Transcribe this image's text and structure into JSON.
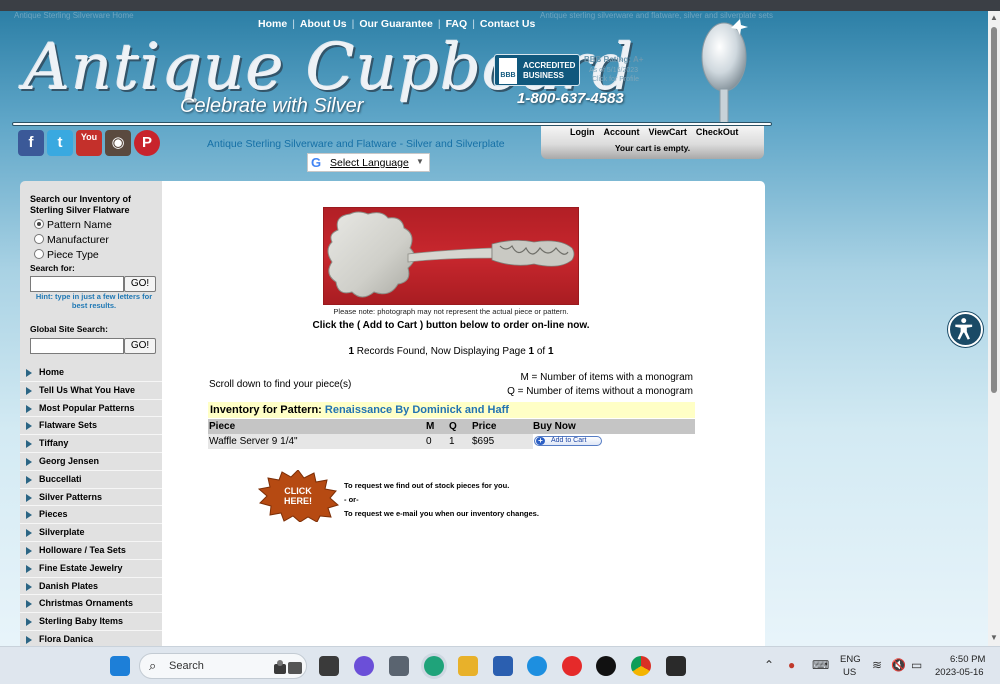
{
  "top_link": "Antique Sterling Silverware Home",
  "top_right_text": "Antique sterling silverware and flatware, silver and silverplate sets",
  "nav": [
    "Home",
    "About Us",
    "Our Guarantee",
    "FAQ",
    "Contact Us"
  ],
  "logo": {
    "title": "Antique Cupboard",
    "subtitle": "Celebrate with Silver"
  },
  "bbb": {
    "badge": "ACCREDITED BUSINESS",
    "icon": "BBB",
    "rating": "BBB Rating: A+",
    "as_of": "As of 5/16/2023",
    "click": "Click for Profile"
  },
  "phone": "1-800-637-4583",
  "tagline": "Antique Sterling Silverware and Flatware - Silver and Silverplate",
  "translate": {
    "label": "Select Language",
    "g": "G"
  },
  "account": {
    "links": [
      "Login",
      "Account",
      "ViewCart",
      "CheckOut"
    ],
    "cart_status": "Your cart is empty."
  },
  "social": [
    {
      "icon": "facebook-icon",
      "glyph": "f",
      "color": "#3b5998"
    },
    {
      "icon": "twitter-icon",
      "glyph": "t",
      "color": "#39a9e0"
    },
    {
      "icon": "youtube-icon",
      "glyph": "You",
      "color": "#c4302b"
    },
    {
      "icon": "instagram-icon",
      "glyph": "◉",
      "color": "#5a4a3f"
    },
    {
      "icon": "pinterest-icon",
      "glyph": "P",
      "color": "#c8232c"
    }
  ],
  "sidebar": {
    "search_title_1": "Search our Inventory of",
    "search_title_2": "Sterling Silver Flatware",
    "radios": [
      "Pattern Name",
      "Manufacturer",
      "Piece Type"
    ],
    "search_for": "Search for:",
    "go": "GO!",
    "hint_1": "Hint: type in just a few letters for",
    "hint_2": "best results.",
    "global_label": "Global Site Search:",
    "menu": [
      "Home",
      "Tell Us What You Have",
      "Most Popular Patterns",
      "Flatware Sets",
      "Tiffany",
      "Georg Jensen",
      "Buccellati",
      "Silver Patterns",
      "Pieces",
      "Silverplate",
      "Holloware / Tea Sets",
      "Fine Estate Jewelry",
      "Danish Plates",
      "Christmas Ornaments",
      "Sterling Baby Items",
      "Flora Danica"
    ]
  },
  "main": {
    "photo_note": "Please note: photograph may not represent the actual piece or pattern.",
    "click_instr": "Click the ( Add to Cart ) button below to order on-line now.",
    "records": {
      "count": "1",
      "mid": " Records Found, Now Displaying Page ",
      "page": "1",
      "of": " of ",
      "total": "1"
    },
    "scroll_note": "Scroll down to find your piece(s)",
    "legend_m": "M = Number of items with a monogram",
    "legend_q": "Q = Number of items without a monogram",
    "pattern_label": "Inventory for Pattern: ",
    "pattern_name": "Renaissance By Dominick and Haff",
    "table": {
      "headers": [
        "Piece",
        "M",
        "Q",
        "Price",
        "Buy Now"
      ],
      "rows": [
        {
          "piece": "Waffle Server  9 1/4\"",
          "m": "0",
          "q": "1",
          "price": "$695",
          "button": "Add to Cart"
        }
      ]
    },
    "click_here": [
      "CLICK",
      "HERE!"
    ],
    "request_1": "To request we find out of stock pieces for you.",
    "request_or": "- or-",
    "request_2": "To request we e-mail you when our inventory changes."
  },
  "taskbar": {
    "search": "Search",
    "lang_1": "ENG",
    "lang_2": "US",
    "time": "6:50 PM",
    "date": "2023-05-16",
    "apps": [
      {
        "icon": "windows-start-icon",
        "color": "#1d7fd8"
      },
      {
        "icon": "task-view-icon",
        "color": "#3a3a3a"
      },
      {
        "icon": "meet-icon",
        "color": "#6b4fd8"
      },
      {
        "icon": "calculator-icon",
        "color": "#5a6470"
      },
      {
        "icon": "edge-icon",
        "color": "#1fa37a"
      },
      {
        "icon": "file-explorer-icon",
        "color": "#e8b12a"
      },
      {
        "icon": "store-icon",
        "color": "#2b5fb0"
      },
      {
        "icon": "app-icon",
        "color": "#1d8fe0"
      },
      {
        "icon": "youtube-music-icon",
        "color": "#e52a2a"
      },
      {
        "icon": "tiktok-icon",
        "color": "#111111"
      },
      {
        "icon": "chrome-icon",
        "color": "#d8a52a"
      },
      {
        "icon": "adobe-icon",
        "color": "#2a2a2a"
      }
    ]
  }
}
